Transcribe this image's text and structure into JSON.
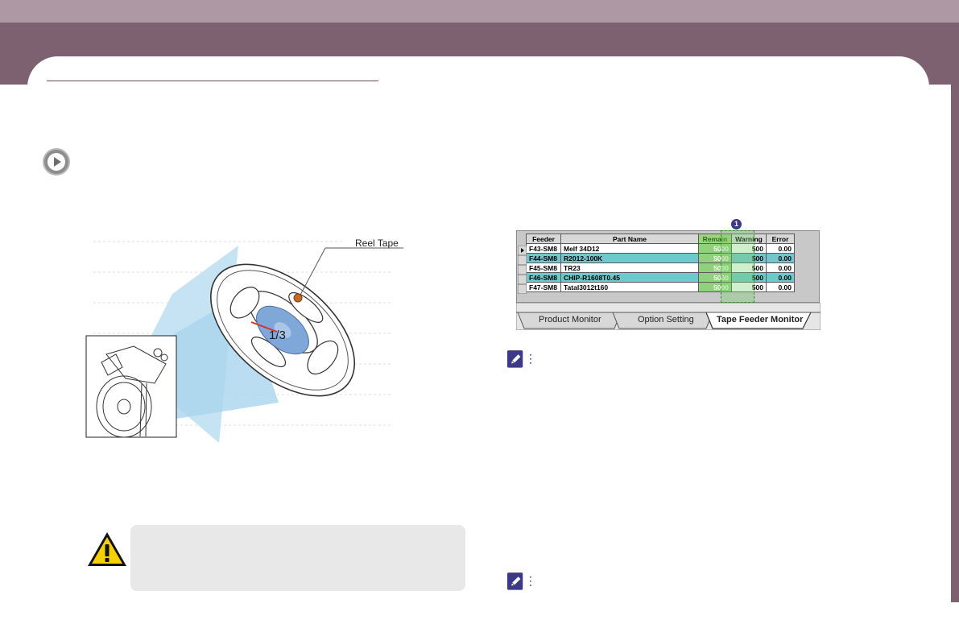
{
  "illustration": {
    "reel_label": "Reel Tape",
    "fraction_label": "1/3"
  },
  "tape_feeder_monitor": {
    "badge": "1",
    "columns": [
      "Feeder",
      "Part Name",
      "Remain",
      "Warning",
      "Error"
    ],
    "rows": [
      {
        "feeder": "F43-SM8",
        "part": "Melf 34D12",
        "remain": "5000",
        "warning": "500",
        "error": "0.00",
        "style": "white"
      },
      {
        "feeder": "F44-SM8",
        "part": "R2012-100K",
        "remain": "5000",
        "warning": "500",
        "error": "0.00",
        "style": "cyan"
      },
      {
        "feeder": "F45-SM8",
        "part": "TR23",
        "remain": "5000",
        "warning": "500",
        "error": "0.00",
        "style": "white"
      },
      {
        "feeder": "F46-SM8",
        "part": "CHIP-R1608T0.45",
        "remain": "5000",
        "warning": "500",
        "error": "0.00",
        "style": "cyan"
      },
      {
        "feeder": "F47-SM8",
        "part": "Tatal3012t160",
        "remain": "5000",
        "warning": "500",
        "error": "0.00",
        "style": "white"
      }
    ],
    "tabs": [
      {
        "label": "Product Monitor",
        "active": false
      },
      {
        "label": "Option Setting",
        "active": false
      },
      {
        "label": "Tape Feeder Monitor",
        "active": true
      }
    ]
  },
  "colors": {
    "header_band": "#7d6170",
    "header_band_light": "#ad98a4",
    "row_highlight": "#6cc9cc",
    "remain_highlight": "#8fd17c",
    "note_icon": "#3c3a86"
  },
  "icons": [
    "play-icon",
    "note-icon",
    "warning-icon"
  ]
}
